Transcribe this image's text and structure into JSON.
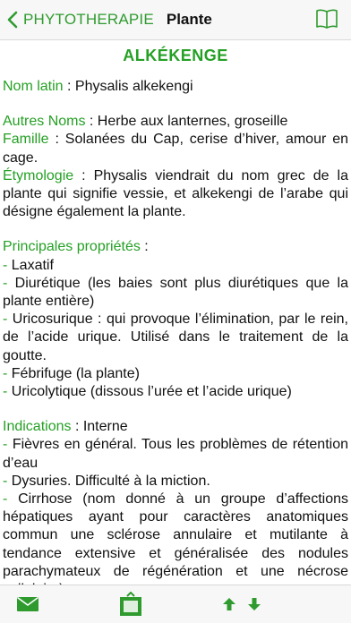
{
  "header": {
    "back_label": "PHYTOTHERAPIE",
    "title": "Plante"
  },
  "plant": {
    "name": "ALKÉKENGE",
    "latin_label": "Nom latin",
    "latin_value": " : Physalis alkekengi",
    "other_names_label": "Autres Noms",
    "other_names_value": " : Herbe aux lanternes, groseille",
    "family_label": "Famille",
    "family_value": " : Solanées du Cap, cerise d’hiver, amour en cage.",
    "etymology_label": "Étymologie",
    "etymology_value": " : Physalis viendrait du nom grec de la plante qui signifie vessie, et alkekengi de l’arabe qui désigne également la plante.",
    "properties_label": "Principales propriétés",
    "properties_suffix": " :",
    "properties": [
      {
        "dash": "- ",
        "text": "Laxatif"
      },
      {
        "dash": "- ",
        "text": "Diurétique (les baies sont plus diurétiques que la plante entière)"
      },
      {
        "dash": "- ",
        "text": "Uricosurique : qui provoque l’élimination, par le rein, de l’acide urique. Utilisé dans le traitement de la goutte."
      },
      {
        "dash": "- ",
        "text": "Fébrifuge (la plante)"
      },
      {
        "dash": "- ",
        "text": "Uricolytique (dissous l’urée et l’acide urique)"
      }
    ],
    "indications_label": "Indications",
    "indications_value": " : Interne",
    "indications": [
      {
        "dash": "- ",
        "text": "Fièvres en général. Tous les problèmes de rétention d’eau"
      },
      {
        "dash": "- ",
        "text": "Dysuries. Difficulté à la miction."
      },
      {
        "dash": "- ",
        "text": "Cirrhose (nom donné à un groupe d’affections hépatiques ayant pour caractères anatomiques commun une sclérose annulaire et mutilante à tendance extensive et généralisée des nodules parachymateux de régénération et une nécrose cellulaire)."
      }
    ]
  },
  "footer": {
    "icons": [
      "mail-icon",
      "share-icon",
      "arrow-up-icon",
      "arrow-down-icon"
    ]
  },
  "colors": {
    "accent": "#25a025",
    "bar_bg": "#f7f7f7"
  }
}
